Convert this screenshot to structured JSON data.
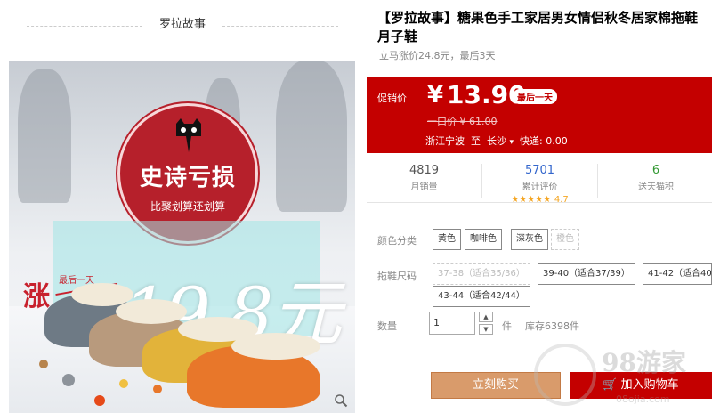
{
  "store": {
    "name": "罗拉故事"
  },
  "hero": {
    "circle_title": "史诗亏损",
    "circle_sub": "比聚划算还划算",
    "rise_label": "涨",
    "last_day_label": "最后一天",
    "big_price": "19.8元"
  },
  "product": {
    "title_line1": "【罗拉故事】糖果色手工家居男女情侣秋冬居家棉拖鞋",
    "title_line2": "月子鞋",
    "promo_note": "立马涨价24.8元，最后3天"
  },
  "price": {
    "label": "促销价",
    "currency": "¥",
    "value": "13.90",
    "badge": "最后一天",
    "original": "一口价 ¥ 61.00",
    "ship_from": "浙江宁波",
    "ship_to_label": "至",
    "ship_to": "长沙",
    "ship_fee": "快递: 0.00"
  },
  "stats": [
    {
      "num": "4819",
      "cap": "月销量",
      "color": "#555555"
    },
    {
      "num": "5701",
      "cap": "累计评价",
      "stars": "★★★★★",
      "rating": "4.7",
      "color": "#3366cc"
    },
    {
      "num": "6",
      "cap": "送天猫积",
      "color": "#339933"
    }
  ],
  "color_row": {
    "label": "颜色分类",
    "options": [
      {
        "label": "黄色",
        "disabled": false
      },
      {
        "label": "咖啡色",
        "disabled": false
      },
      {
        "label": "深灰色",
        "disabled": false
      },
      {
        "label": "橙色",
        "disabled": true
      }
    ]
  },
  "size_row": {
    "label": "拖鞋尺码",
    "options": [
      {
        "label": "37-38（适合35/36）",
        "disabled": true
      },
      {
        "label": "39-40（适合37/39）",
        "disabled": false
      },
      {
        "label": "41-42（适合40",
        "disabled": false
      },
      {
        "label": "43-44（适合42/44）",
        "disabled": false
      }
    ]
  },
  "quantity": {
    "label": "数量",
    "value": "1",
    "unit": "件",
    "stock": "库存6398件"
  },
  "actions": {
    "buy": "立刻购买",
    "cart": "加入购物车"
  },
  "watermark": {
    "text": "98游家",
    "sub": "08ojia.com"
  },
  "colors": {
    "price_red": "#c40000",
    "buy_orange": "#d99b6b"
  }
}
